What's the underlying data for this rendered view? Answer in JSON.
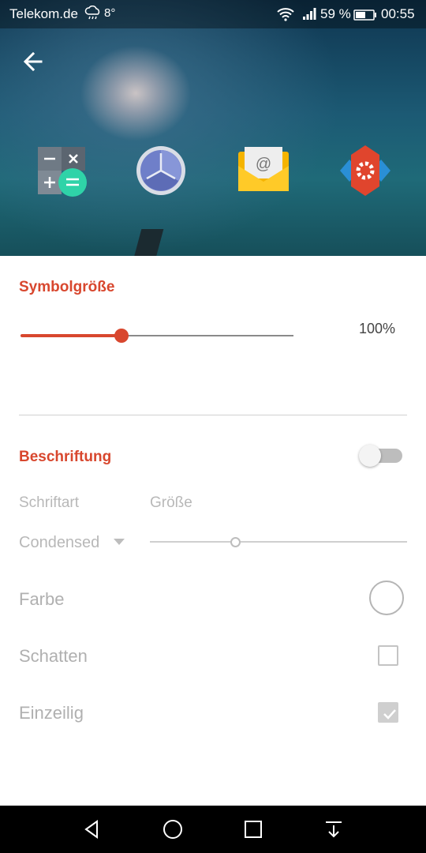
{
  "status_bar": {
    "carrier": "Telekom.de",
    "temperature": "8°",
    "battery_percent": "59 %",
    "time": "00:55"
  },
  "header": {
    "icons": [
      "back-arrow-icon",
      "calculator-icon",
      "clock-icon",
      "email-icon",
      "settings-hexagon-icon"
    ]
  },
  "icon_size": {
    "title": "Symbolgröße",
    "value_label": "100%",
    "slider_fraction": 0.37
  },
  "labeling": {
    "title": "Beschriftung",
    "enabled": false,
    "font_label": "Schriftart",
    "size_label": "Größe",
    "font_value": "Condensed",
    "size_slider_fraction": 0.33,
    "color_label": "Farbe",
    "shadow_label": "Schatten",
    "shadow_checked": false,
    "single_line_label": "Einzeilig",
    "single_line_checked": true
  },
  "colors": {
    "accent": "#d8472e"
  },
  "nav_bar": {
    "icons": [
      "back-triangle-icon",
      "home-circle-icon",
      "recents-square-icon",
      "notification-pull-icon"
    ]
  }
}
